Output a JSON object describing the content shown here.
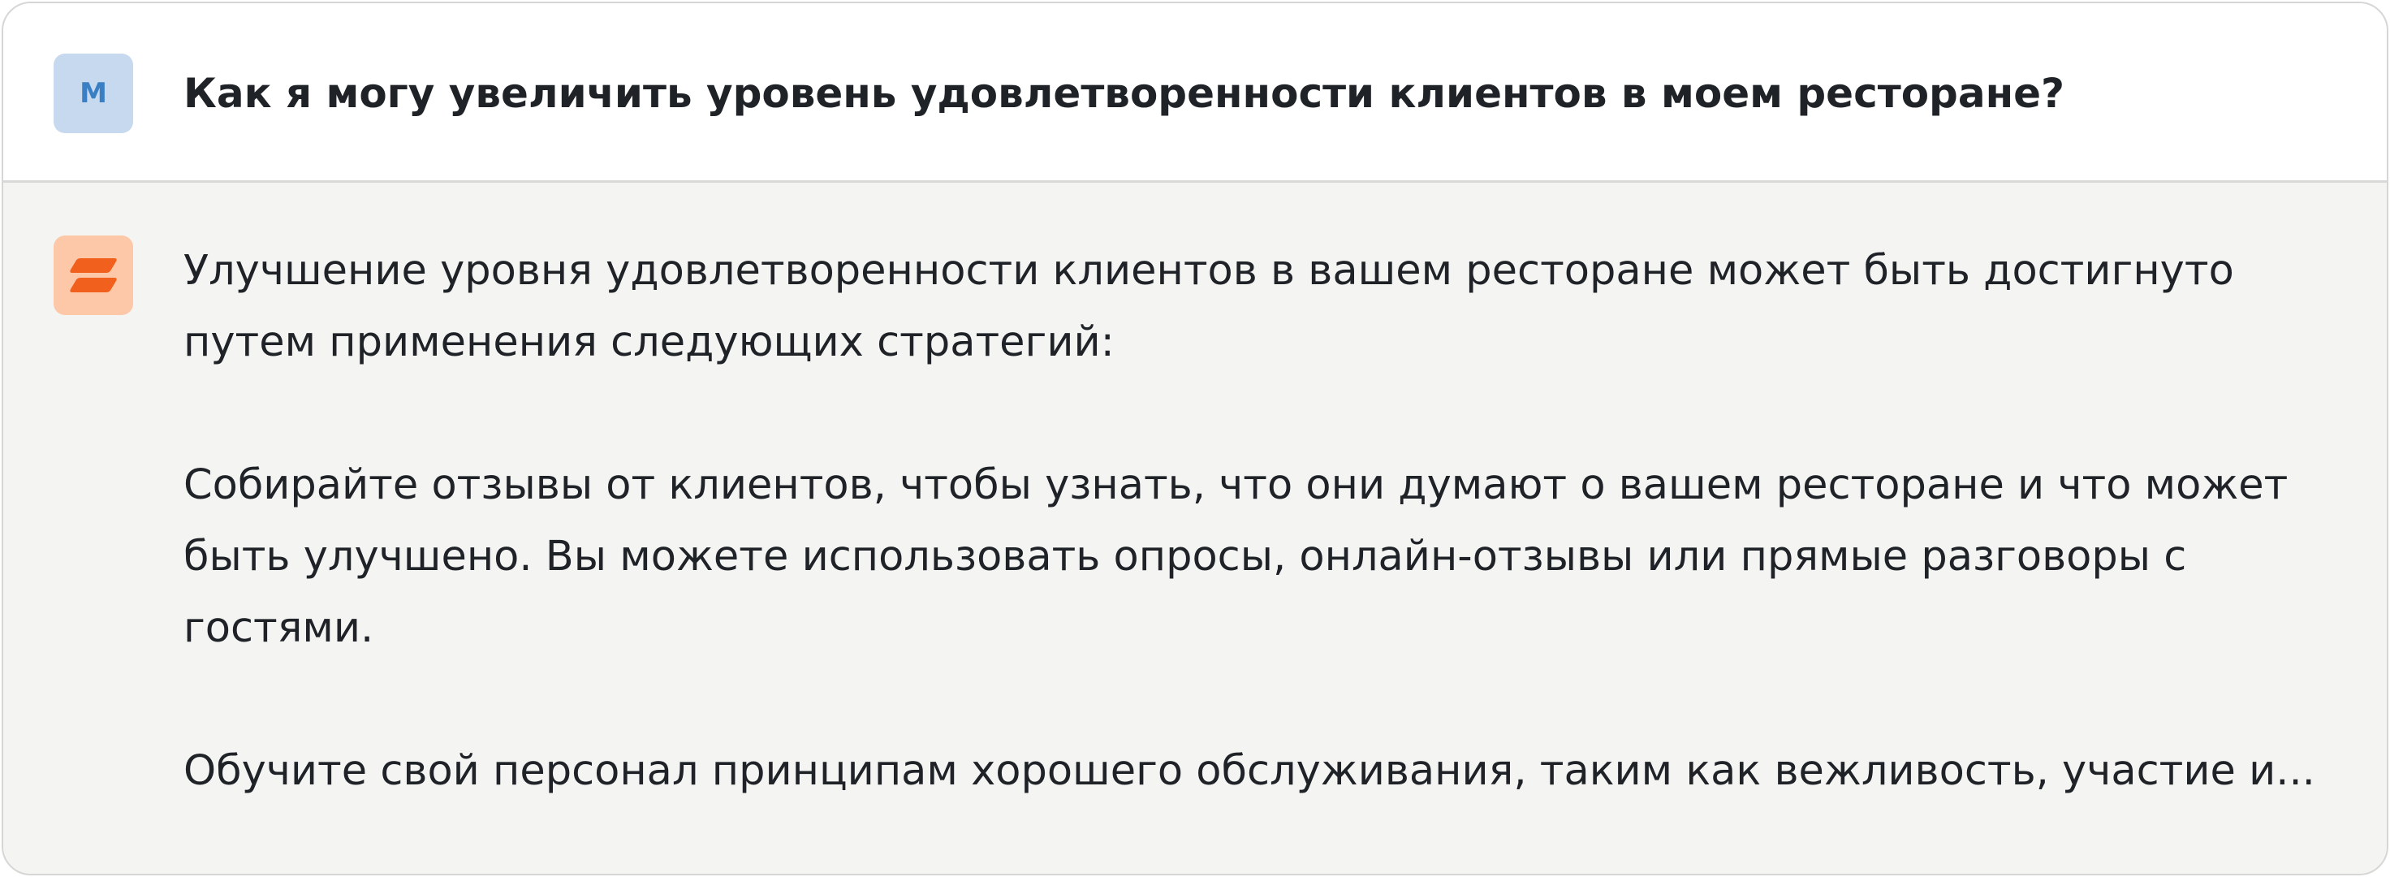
{
  "user_message": {
    "avatar_initial": "M",
    "text": "Как я могу увеличить уровень удовлетворенности клиентов в моем ресторане?"
  },
  "assistant_message": {
    "avatar_icon": "brand-logo-icon",
    "paragraphs": [
      "Улучшение уровня удовлетворенности клиентов в вашем ресторане может быть достигнуто\nпутем применения следующих стратегий:",
      "Собирайте отзывы от клиентов, чтобы узнать, что они думают о вашем ресторане и что может\nбыть улучшено. Вы можете использовать опросы, онлайн-отзывы или прямые разговоры с\nгостями.",
      "Обучите свой персонал принципам хорошего обслуживания, таким как вежливость, участие и..."
    ]
  },
  "colors": {
    "user_avatar_bg": "#c7d9ee",
    "user_avatar_text": "#3a7fc4",
    "assistant_avatar_bg": "#fcc8a8",
    "brand_orange": "#f2601e",
    "assistant_bg": "#f4f4f3"
  }
}
